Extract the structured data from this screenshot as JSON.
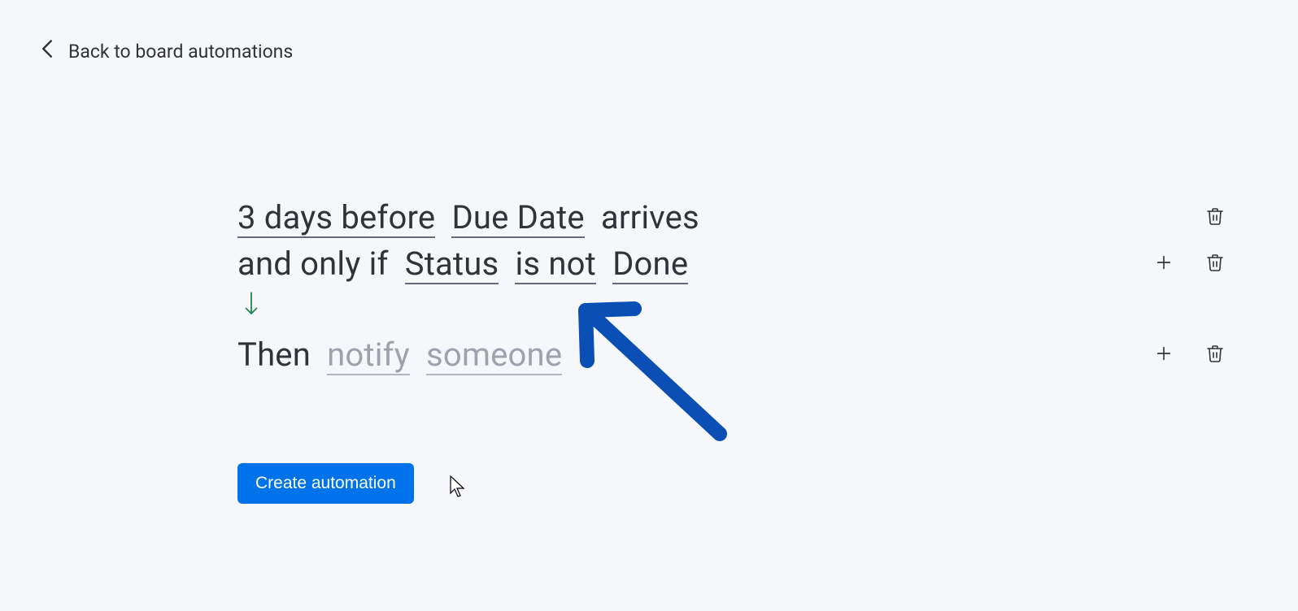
{
  "back": {
    "label": "Back to board automations"
  },
  "trigger": {
    "time_amount": "3 days before",
    "date_field": "Due Date",
    "suffix": "arrives"
  },
  "condition": {
    "prefix": "and only if",
    "field": "Status",
    "operator": "is not",
    "value": "Done"
  },
  "action": {
    "prefix": "Then",
    "verb": "notify",
    "target": "someone"
  },
  "button": {
    "create": "Create automation"
  }
}
